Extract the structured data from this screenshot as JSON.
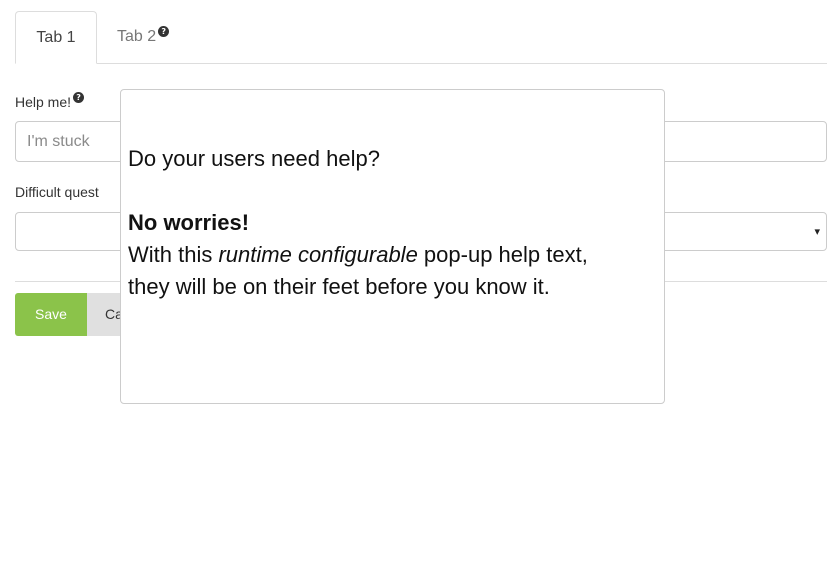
{
  "tabs": [
    {
      "label": "Tab 1",
      "active": true
    },
    {
      "label": "Tab 2",
      "active": false,
      "has_help_icon": true
    }
  ],
  "help_icon_glyph": "?",
  "form": {
    "help_label": "Help me!",
    "help_input_placeholder": "I'm stuck",
    "difficult_label": "Difficult quest",
    "select_value": "",
    "select_arrow": "▾"
  },
  "buttons": {
    "save": "Save",
    "cancel": "Ca"
  },
  "popover": {
    "line1": "Do your users need help?",
    "heading": "No worries!",
    "line3_prefix": "With this ",
    "line3_em": "runtime configurable",
    "line3_suffix": " pop-up help text,",
    "line4": "they will be on their feet before you know it."
  },
  "colors": {
    "save_button": "#8bc34a",
    "cancel_button": "#e0e0e0",
    "border": "#cccccc"
  }
}
